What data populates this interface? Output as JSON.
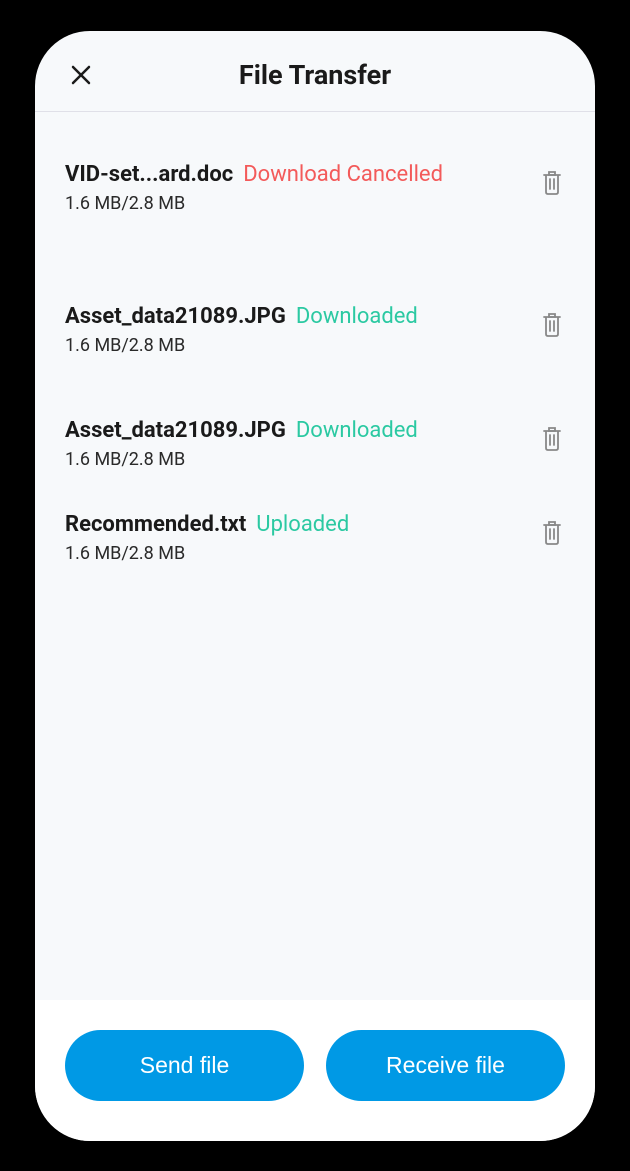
{
  "header": {
    "title": "File Transfer"
  },
  "files": [
    {
      "name": "VID-set...ard.doc",
      "status": "Download Cancelled",
      "statusType": "error",
      "size": "1.6 MB/2.8 MB"
    },
    {
      "name": "Asset_data21089.JPG",
      "status": "Downloaded",
      "statusType": "success",
      "size": "1.6 MB/2.8 MB"
    },
    {
      "name": "Asset_data21089.JPG",
      "status": "Downloaded",
      "statusType": "success",
      "size": "1.6 MB/2.8 MB"
    },
    {
      "name": "Recommended.txt",
      "status": "Uploaded",
      "statusType": "success",
      "size": "1.6 MB/2.8 MB"
    }
  ],
  "buttons": {
    "send": "Send file",
    "receive": "Receive file"
  }
}
